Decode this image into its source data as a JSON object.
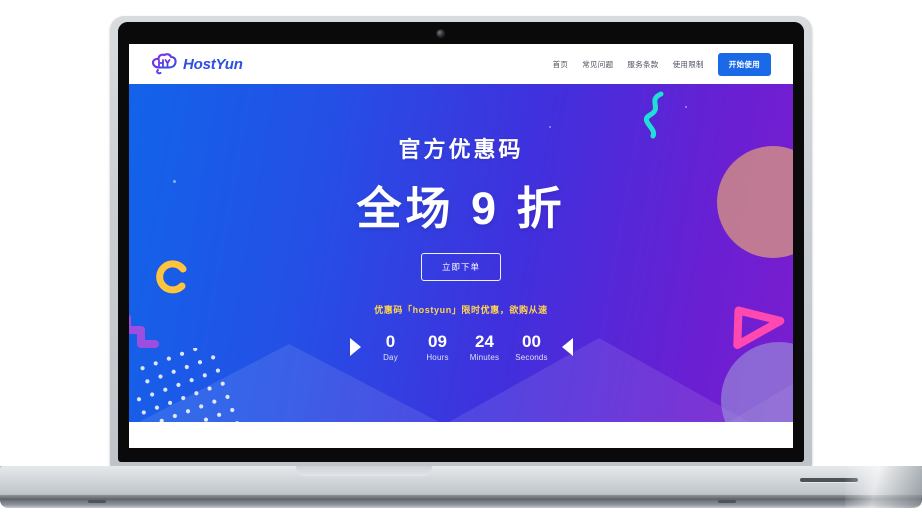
{
  "device": {
    "type": "laptop-mockup",
    "webcam": "webcam-dot"
  },
  "site": {
    "header": {
      "brand_name": "HostYun",
      "brand_icon": "hostyun-cloud-logo",
      "nav_links": [
        {
          "label": "首页"
        },
        {
          "label": "常见问题"
        },
        {
          "label": "服务条款"
        },
        {
          "label": "使用限制"
        }
      ],
      "cta_label": "开始使用"
    },
    "hero": {
      "kicker": "官方优惠码",
      "headline": "全场 9 折",
      "button_label": "立即下单",
      "promo_text": "优惠码「hostyun」限时优惠，欲购从速",
      "countdown": {
        "prev_arrow": "triangle-right-icon",
        "next_arrow": "triangle-left-icon",
        "units": [
          {
            "value": "0",
            "label": "Day"
          },
          {
            "value": "09",
            "label": "Hours"
          },
          {
            "value": "24",
            "label": "Minutes"
          },
          {
            "value": "00",
            "label": "Seconds"
          }
        ]
      },
      "decorations": [
        {
          "name": "cyan-squiggle"
        },
        {
          "name": "rose-circle"
        },
        {
          "name": "pink-triangle"
        },
        {
          "name": "yellow-arc"
        },
        {
          "name": "purple-zigzag"
        },
        {
          "name": "white-dot-grid"
        },
        {
          "name": "lavender-circle"
        },
        {
          "name": "mountain-silhouette"
        }
      ]
    }
  },
  "colors": {
    "gradient_start": "#1263e9",
    "gradient_end": "#7a1ecf",
    "brand_blue": "#2f4fe0",
    "cta_blue": "#1a6ae8",
    "promo_yellow": "#ffd64d",
    "cyan": "#20e0d6",
    "pink": "#ff49b0",
    "amber": "#ffc33c",
    "violet": "#9b4ee0",
    "rose": "#c4808f"
  }
}
